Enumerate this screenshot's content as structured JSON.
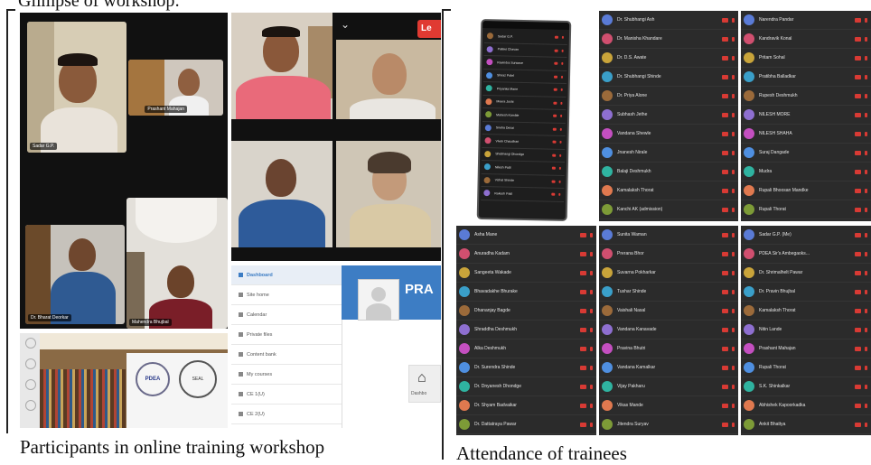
{
  "heading": "Glimpse of workshop:",
  "left_caption": "Participants in online training workshop",
  "right_caption": "Attendance of trainees",
  "video_tiles": {
    "leave_button": "Le",
    "names": [
      "Sadar G.P.",
      "Prashant Mahajan",
      "Dr. Bharat Deorkar",
      "Mahendra Bhujbal"
    ]
  },
  "lms": {
    "menu": [
      "Dashboard",
      "Site home",
      "Calendar",
      "Private files",
      "Content bank",
      "My courses",
      "CE 1(U)",
      "CE 2(U)"
    ],
    "banner": "PRA",
    "tile_label": "Dashbo"
  },
  "seal": {
    "left": "PDEA",
    "right": "SEAL"
  },
  "attendance": {
    "phone_list": [
      "Sadar G.P.",
      "Pallavi Chavan",
      "Ravindra Surwase",
      "Shiraz Patel",
      "Priyanka Mane",
      "Meera Joshi",
      "Mahesh Kamble",
      "Sneha Desai",
      "Vivek Chaudhari",
      "Shubhangi Dhondge",
      "Nilesh Patil",
      "Vishal Shinde",
      "Rakesh Patil"
    ],
    "panel1": [
      "Dr. Shubhangi Ash",
      "Dr. Manisha Khandare",
      "Dr. D.S. Awate",
      "Dr. Shubhangi Shinde",
      "Dr. Priya Alone",
      "Subhash Jethe",
      "Vandana Shewle",
      "Jnanesh Nirale",
      "Balaji Deshmukh",
      "Kamalaksh Thorat",
      "Kanchi AK (admission)"
    ],
    "panel2": [
      "Narendra Pandar",
      "Kandravik Konal",
      "Pritam Sohal",
      "Pratibha Balladkar",
      "Rupesh Deshmukh",
      "NILESH MORE",
      "NILESH SHAHA",
      "Suraj Dangade",
      "Mudra",
      "Rupali Bhoosan Mandke",
      "Rupali Thorat"
    ],
    "panel3": [
      "Asha Mane",
      "Anuradha Kadam",
      "Sangeeta Wakade",
      "Bhavadakhe Bhurake",
      "Dhananjay Bagde",
      "Shraddha Deshmukh",
      "Alka Deshmukh",
      "Dr. Surendra Shinde",
      "Dr. Dnyanesh Dhondge",
      "Dr. Shyam Badvaikar",
      "Dr. Dattatraya Pawar"
    ],
    "panel4": [
      "Sunita Waman",
      "Prerana Bhor",
      "Suvarna Pokharkar",
      "Tushar Shinde",
      "Vaishali Nasal",
      "Vandana Kanavade",
      "Pravina Bhutri",
      "Vandana Kamalkar",
      "Vijay Pakharu",
      "Vikas Mande",
      "Jitendra Suryav"
    ],
    "panel5": [
      "Sadar G.P. (Me)",
      "PDEA Sir's Ambegaoks...",
      "Dr. Shrimalhelt Pawar",
      "Dr. Pravin Bhujbal",
      "Kamalaksh Thorat",
      "Nitin Lande",
      "Prashant Mahajan",
      "Rupali Thorat",
      "S.K. Shinkalkar",
      "Abhishek Kapoorkadka",
      "Ankit Bhattya"
    ]
  },
  "colors": {
    "avatars": [
      "#8e6fd0",
      "#c44fc0",
      "#4f8fe0",
      "#2fb3a0",
      "#e0794f",
      "#7d9b37",
      "#5a7bd6",
      "#d04f6f",
      "#c9a43a",
      "#3a9fc9",
      "#9b6a3a"
    ],
    "mic_off": "#d83a34",
    "list_bg": "#2b2b2b",
    "lms_blue": "#3d7dc4"
  }
}
